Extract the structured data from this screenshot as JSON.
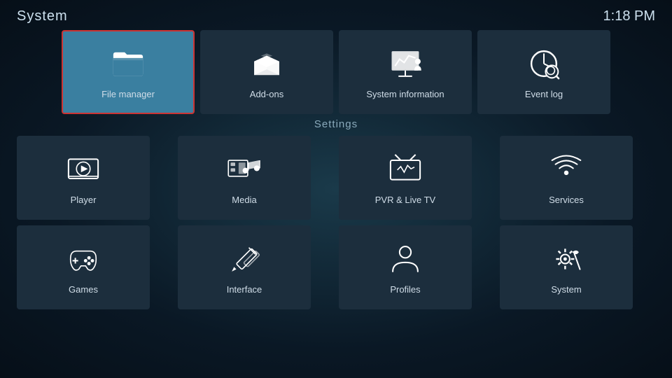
{
  "header": {
    "title": "System",
    "time": "1:18 PM"
  },
  "top_tiles": [
    {
      "id": "file-manager",
      "label": "File manager",
      "active": true
    },
    {
      "id": "add-ons",
      "label": "Add-ons",
      "active": false
    },
    {
      "id": "system-information",
      "label": "System information",
      "active": false
    },
    {
      "id": "event-log",
      "label": "Event log",
      "active": false
    }
  ],
  "settings": {
    "title": "Settings",
    "tiles": [
      {
        "id": "player",
        "label": "Player"
      },
      {
        "id": "media",
        "label": "Media"
      },
      {
        "id": "pvr-live-tv",
        "label": "PVR & Live TV"
      },
      {
        "id": "services",
        "label": "Services"
      },
      {
        "id": "games",
        "label": "Games"
      },
      {
        "id": "interface",
        "label": "Interface"
      },
      {
        "id": "profiles",
        "label": "Profiles"
      },
      {
        "id": "system",
        "label": "System"
      }
    ]
  }
}
